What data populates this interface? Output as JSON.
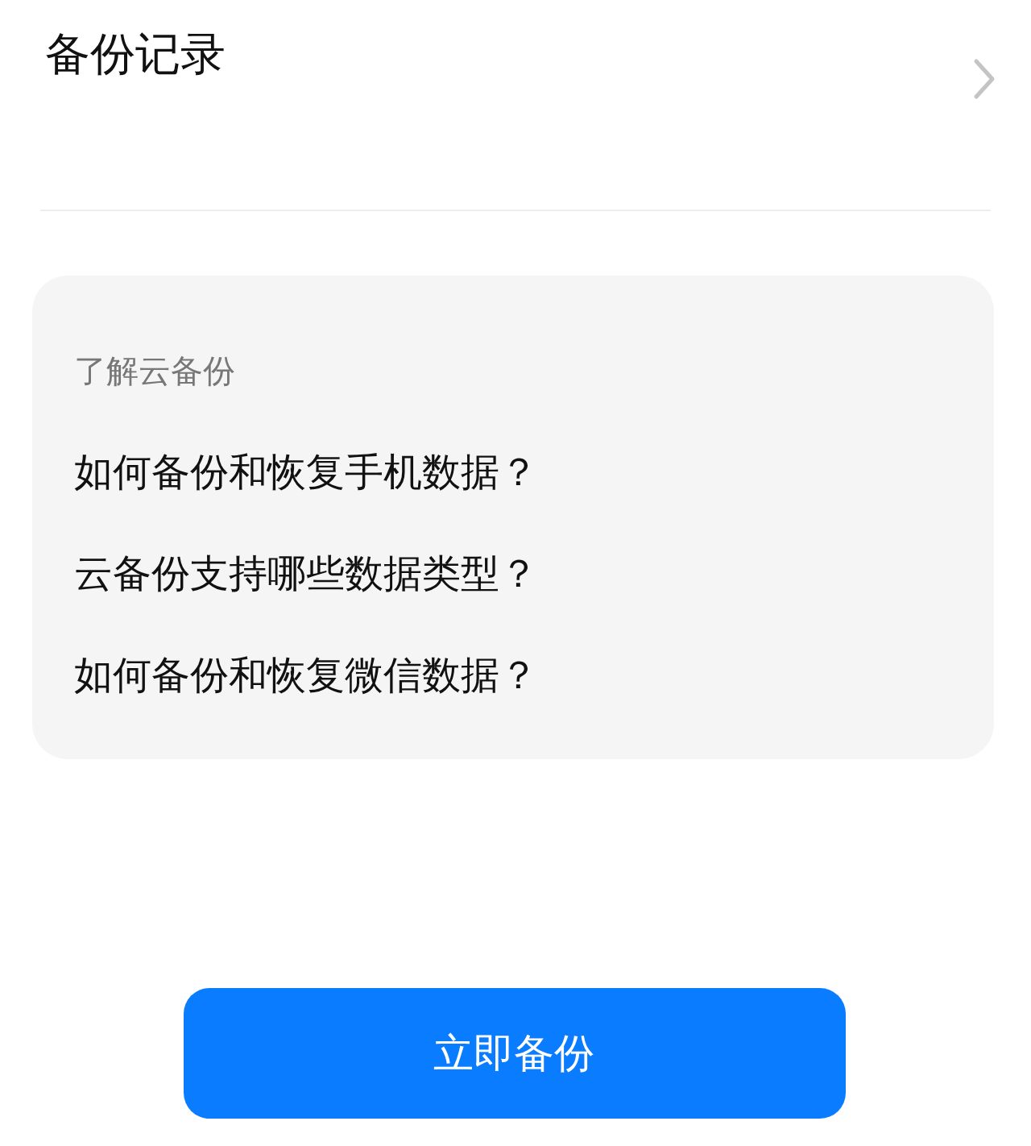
{
  "backup_records": {
    "title": "备份记录"
  },
  "help_card": {
    "heading": "了解云备份",
    "links": [
      {
        "text": "如何备份和恢复手机数据？"
      },
      {
        "text": "云备份支持哪些数据类型？"
      },
      {
        "text": "如何备份和恢复微信数据？"
      }
    ]
  },
  "primary_button": {
    "label": "立即备份"
  }
}
